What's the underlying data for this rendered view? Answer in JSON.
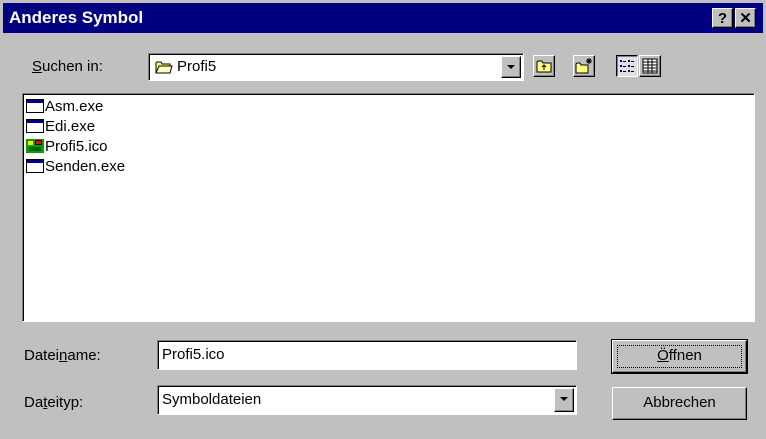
{
  "window": {
    "title": "Anderes Symbol",
    "help_button": "?",
    "close_button": "✕"
  },
  "look_in": {
    "label_underlined": "S",
    "label_rest": "uchen in:",
    "value": "Profi5",
    "icon": "folder-icon"
  },
  "toolbar": {
    "up_icon": "folder-up-icon",
    "new_folder_icon": "new-folder-icon",
    "list_view_icon": "list-view-icon",
    "details_view_icon": "details-view-icon"
  },
  "files": [
    {
      "name": "Asm.exe",
      "icon": "exe-icon"
    },
    {
      "name": "Edi.exe",
      "icon": "exe-icon"
    },
    {
      "name": "Profi5.ico",
      "icon": "ico-file-icon"
    },
    {
      "name": "Senden.exe",
      "icon": "exe-icon"
    }
  ],
  "filename": {
    "label_pre": "Datei",
    "label_underlined": "n",
    "label_post": "ame:",
    "value": "Profi5.ico"
  },
  "filetype": {
    "label_pre": "Da",
    "label_underlined": "t",
    "label_post": "eityp:",
    "value": "Symboldateien"
  },
  "buttons": {
    "open_underlined": "Ö",
    "open_rest": "ffnen",
    "cancel": "Abbrechen"
  }
}
